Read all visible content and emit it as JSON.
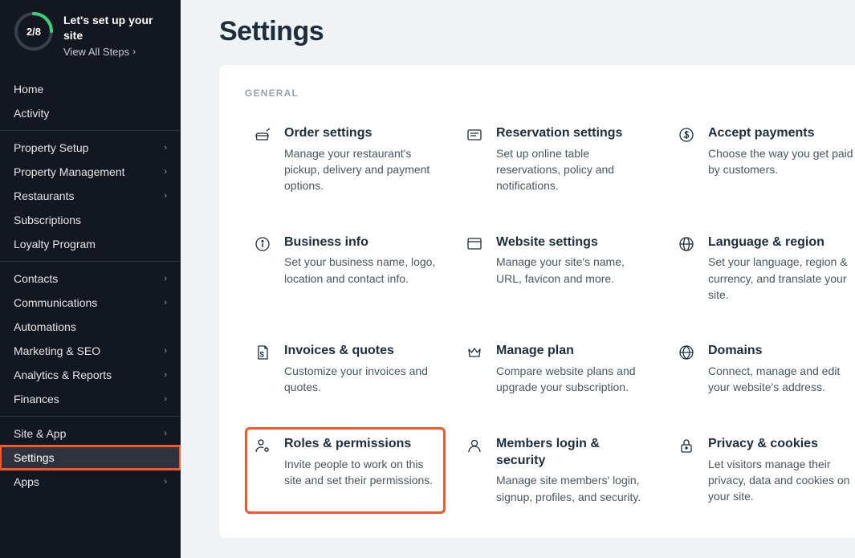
{
  "setup": {
    "progress_text": "2/8",
    "title": "Let's set up your site",
    "link": "View All Steps"
  },
  "nav": {
    "groups": [
      {
        "items": [
          {
            "label": "Home",
            "chevron": false
          },
          {
            "label": "Activity",
            "chevron": false
          }
        ]
      },
      {
        "items": [
          {
            "label": "Property Setup",
            "chevron": true
          },
          {
            "label": "Property Management",
            "chevron": true
          },
          {
            "label": "Restaurants",
            "chevron": true
          },
          {
            "label": "Subscriptions",
            "chevron": false
          },
          {
            "label": "Loyalty Program",
            "chevron": false
          }
        ]
      },
      {
        "items": [
          {
            "label": "Contacts",
            "chevron": true
          },
          {
            "label": "Communications",
            "chevron": true
          },
          {
            "label": "Automations",
            "chevron": false
          },
          {
            "label": "Marketing & SEO",
            "chevron": true
          },
          {
            "label": "Analytics & Reports",
            "chevron": true
          },
          {
            "label": "Finances",
            "chevron": true
          }
        ]
      },
      {
        "items": [
          {
            "label": "Site & App",
            "chevron": true
          },
          {
            "label": "Settings",
            "chevron": false,
            "active": true,
            "highlighted": true
          },
          {
            "label": "Apps",
            "chevron": true
          }
        ]
      }
    ]
  },
  "page": {
    "title": "Settings",
    "section_label": "GENERAL",
    "cards": [
      {
        "icon": "restaurant-icon",
        "title": "Order settings",
        "desc": "Manage your restaurant's pickup, delivery and payment options."
      },
      {
        "icon": "reservation-icon",
        "title": "Reservation settings",
        "desc": "Set up online table reservations, policy and notifications."
      },
      {
        "icon": "dollar-icon",
        "title": "Accept payments",
        "desc": "Choose the way you get paid by customers."
      },
      {
        "icon": "info-icon",
        "title": "Business info",
        "desc": "Set your business name, logo, location and contact info."
      },
      {
        "icon": "browser-icon",
        "title": "Website settings",
        "desc": "Manage your site's name, URL, favicon and more."
      },
      {
        "icon": "globe-icon",
        "title": "Language & region",
        "desc": "Set your language, region & currency, and translate your site."
      },
      {
        "icon": "invoice-icon",
        "title": "Invoices & quotes",
        "desc": "Customize your invoices and quotes."
      },
      {
        "icon": "crown-icon",
        "title": "Manage plan",
        "desc": "Compare website plans and upgrade your subscription."
      },
      {
        "icon": "domain-icon",
        "title": "Domains",
        "desc": "Connect, manage and edit your website's address."
      },
      {
        "icon": "roles-icon",
        "title": "Roles & permissions",
        "desc": "Invite people to work on this site and set their permissions.",
        "highlighted": true
      },
      {
        "icon": "member-icon",
        "title": "Members login & security",
        "desc": "Manage site members' login, signup, profiles, and security."
      },
      {
        "icon": "lock-icon",
        "title": "Privacy & cookies",
        "desc": "Let visitors manage their privacy, data and cookies on your site."
      }
    ]
  }
}
